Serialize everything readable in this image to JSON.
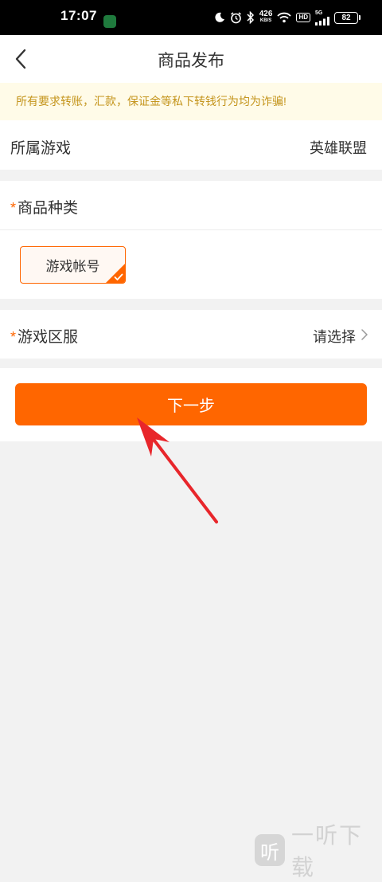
{
  "status_bar": {
    "time": "17:07",
    "net_speed": "426",
    "net_unit": "KB/S",
    "network_type": "5G",
    "hd_label": "HD",
    "battery": "82"
  },
  "nav": {
    "title": "商品发布"
  },
  "notice": {
    "text": "所有要求转账，汇款，保证金等私下转钱行为均为诈骗!"
  },
  "game_row": {
    "label": "所属游戏",
    "value": "英雄联盟"
  },
  "category": {
    "required_mark": "*",
    "label": "商品种类",
    "options": [
      "游戏帐号"
    ],
    "selected": "游戏帐号"
  },
  "server_row": {
    "required_mark": "*",
    "label": "游戏区服",
    "value": "请选择"
  },
  "next_button": {
    "label": "下一步"
  },
  "watermark": {
    "logo_char": "听",
    "text": "一听下载"
  },
  "colors": {
    "accent": "#ff6600",
    "notice_text": "#c4941b",
    "notice_bg": "#fffbe8",
    "arrow": "#e8262b"
  }
}
